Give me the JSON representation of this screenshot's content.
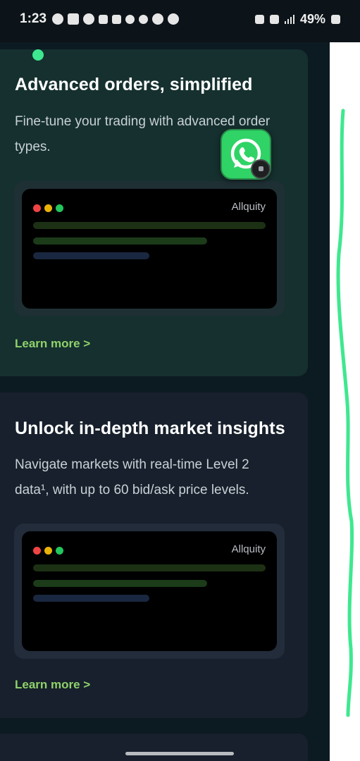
{
  "status_bar": {
    "time": "1:23",
    "battery": "49%"
  },
  "cards": [
    {
      "title": "Advanced orders, simplified",
      "description": "Fine-tune your trading with advanced order types.",
      "preview_brand": "Allquity",
      "link": "Learn more >"
    },
    {
      "title": "Unlock in-depth market insights",
      "description": "Navigate markets with real-time Level 2 data¹, with up to 60 bid/ask price levels.",
      "preview_brand": "Allquity",
      "link": "Learn more >"
    }
  ],
  "floating_app": {
    "icon": "whatsapp-icon",
    "color": "#2fd366"
  },
  "colors": {
    "accent_link": "#8fd26a",
    "card1_bg": "#15302f",
    "card2_bg": "#17202c",
    "annotation": "#3ee88f"
  }
}
